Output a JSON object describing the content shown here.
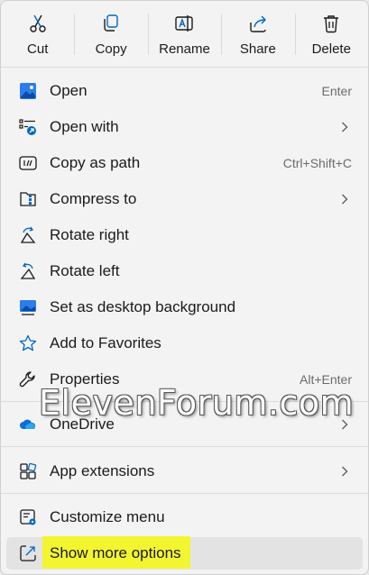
{
  "actions": [
    {
      "label": "Cut",
      "icon": "scissors-icon"
    },
    {
      "label": "Copy",
      "icon": "copy-icon"
    },
    {
      "label": "Rename",
      "icon": "rename-icon"
    },
    {
      "label": "Share",
      "icon": "share-icon"
    },
    {
      "label": "Delete",
      "icon": "trash-icon"
    }
  ],
  "items": [
    {
      "label": "Open",
      "shortcut": "Enter",
      "icon": "image-open-icon"
    },
    {
      "label": "Open with",
      "submenu": true,
      "icon": "open-with-icon"
    },
    {
      "label": "Copy as path",
      "shortcut": "Ctrl+Shift+C",
      "icon": "copy-path-icon"
    },
    {
      "label": "Compress to",
      "submenu": true,
      "icon": "zip-icon"
    },
    {
      "label": "Rotate right",
      "icon": "rotate-right-icon"
    },
    {
      "label": "Rotate left",
      "icon": "rotate-left-icon"
    },
    {
      "label": "Set as desktop background",
      "icon": "desktop-background-icon"
    },
    {
      "label": "Add to Favorites",
      "icon": "star-icon"
    },
    {
      "label": "Properties",
      "shortcut": "Alt+Enter",
      "icon": "wrench-icon"
    },
    {
      "label": "OneDrive",
      "submenu": true,
      "icon": "onedrive-cloud-icon"
    },
    {
      "label": "App extensions",
      "submenu": true,
      "icon": "app-extensions-icon"
    },
    {
      "label": "Customize menu",
      "icon": "customize-menu-icon"
    },
    {
      "label": "Show more options",
      "icon": "show-more-icon",
      "hovered": true
    }
  ],
  "watermark": "ElevenForum.com",
  "colors": {
    "accent": "#0067c0",
    "highlight": "#f3f531",
    "menu_bg": "#f3f3f3"
  }
}
